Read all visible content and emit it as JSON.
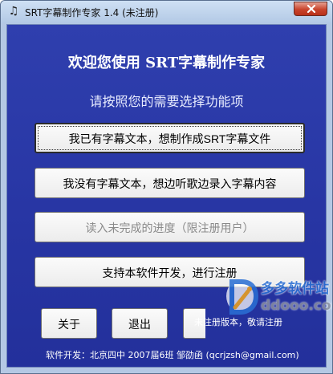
{
  "window": {
    "title": "SRT字幕制作专家 1.4 (未注册)",
    "icon": "music-note-icon"
  },
  "main": {
    "welcome": "欢迎您使用 SRT字幕制作专家",
    "subtitle": "请按照您的需要选择功能项",
    "buttons": [
      {
        "label": "我已有字幕文本，想制作成SRT字幕文件",
        "state": "focused"
      },
      {
        "label": "我没有字幕文本，想边听歌边录入字幕内容",
        "state": "normal"
      },
      {
        "label": "读入未完成的进度（限注册用户）",
        "state": "disabled"
      },
      {
        "label": "支持本软件开发，进行注册",
        "state": "normal"
      }
    ]
  },
  "bottom": {
    "about_label": "关于",
    "quit_label": "退出",
    "registration_status": "未注册版本，敬请注册",
    "footer": "软件开发：北京四中 2007届6班 邹劭函 (qcrjzsh@gmail.com)"
  },
  "watermark": {
    "name": "多多软件站",
    "url": "ddooo.com"
  },
  "colors": {
    "client_bg": "#2a38a6",
    "titlebar": "#c3d6ef",
    "close_button": "#c9442c",
    "watermark_blue": "#2a6fd4"
  }
}
